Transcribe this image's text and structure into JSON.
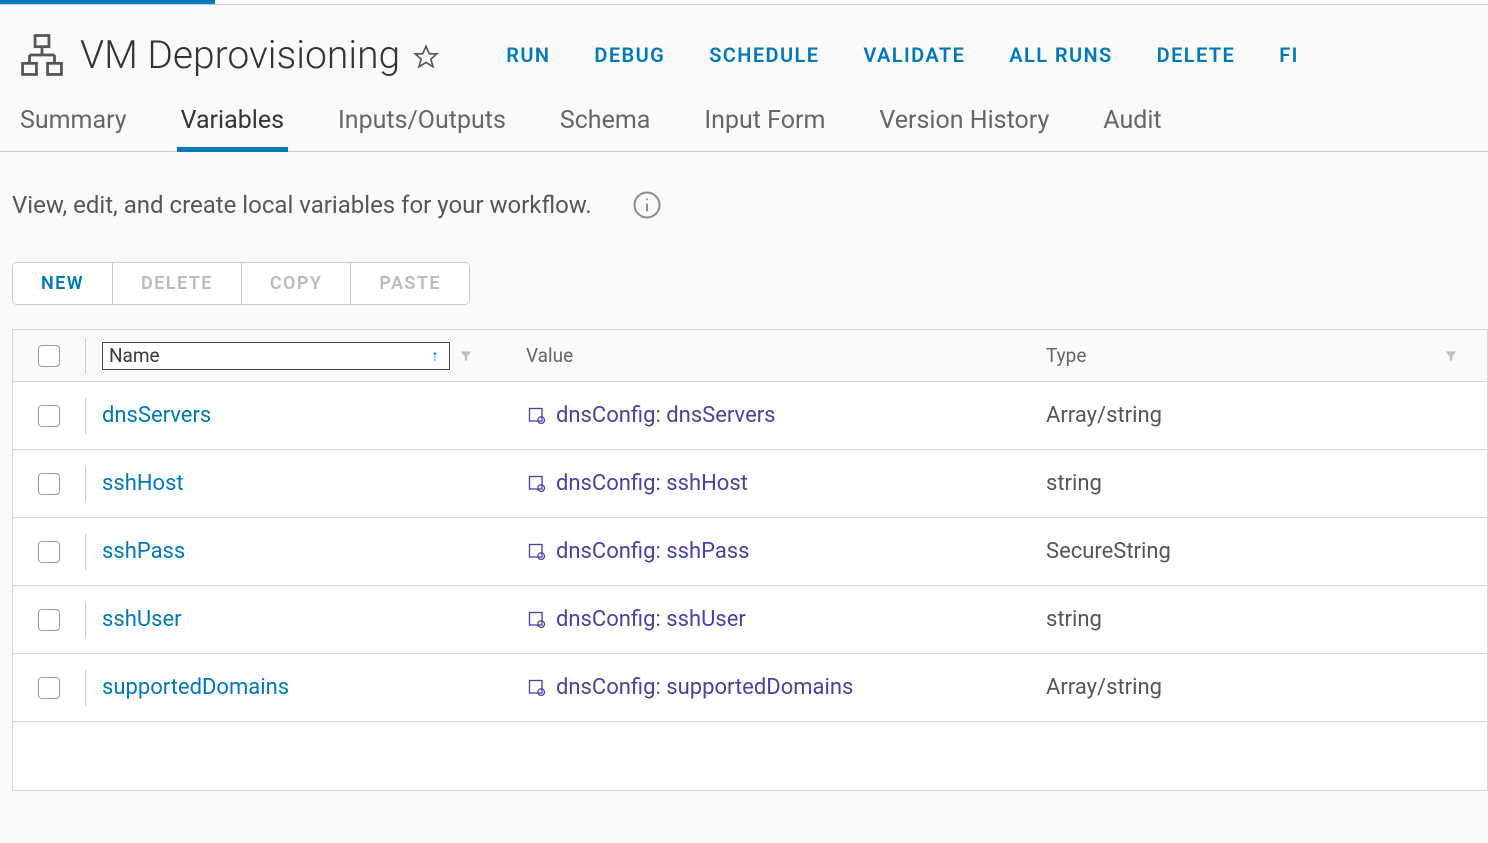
{
  "header": {
    "title": "VM Deprovisioning"
  },
  "actions": {
    "run": "RUN",
    "debug": "DEBUG",
    "schedule": "SCHEDULE",
    "validate": "VALIDATE",
    "all_runs": "ALL RUNS",
    "delete": "DELETE",
    "fi": "FI"
  },
  "tabs": {
    "summary": "Summary",
    "variables": "Variables",
    "inputs_outputs": "Inputs/Outputs",
    "schema": "Schema",
    "input_form": "Input Form",
    "version_history": "Version History",
    "audit": "Audit"
  },
  "description": "View, edit, and create local variables for your workflow.",
  "toolbar": {
    "new": "NEW",
    "delete": "DELETE",
    "copy": "COPY",
    "paste": "PASTE"
  },
  "columns": {
    "name": "Name",
    "value": "Value",
    "type": "Type"
  },
  "rows": [
    {
      "name": "dnsServers",
      "value": "dnsConfig: dnsServers",
      "type": "Array/string"
    },
    {
      "name": "sshHost",
      "value": "dnsConfig: sshHost",
      "type": "string"
    },
    {
      "name": "sshPass",
      "value": "dnsConfig: sshPass",
      "type": "SecureString"
    },
    {
      "name": "sshUser",
      "value": "dnsConfig: sshUser",
      "type": "string"
    },
    {
      "name": "supportedDomains",
      "value": "dnsConfig: supportedDomains",
      "type": "Array/string"
    }
  ]
}
